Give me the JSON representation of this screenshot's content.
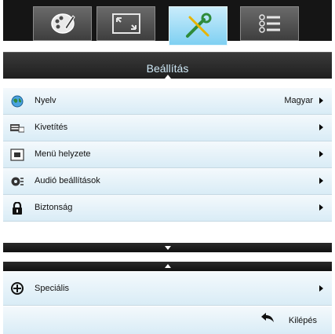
{
  "tabs": [
    {
      "icon": "palette-icon",
      "active": false
    },
    {
      "icon": "screen-icon",
      "active": false
    },
    {
      "icon": "tools-icon",
      "active": true
    },
    {
      "icon": "list-options-icon",
      "active": false
    }
  ],
  "header": {
    "title": "Beállítás"
  },
  "menu": {
    "items": [
      {
        "label": "Nyelv",
        "value": "Magyar",
        "icon": "globe-icon"
      },
      {
        "label": "Kivetítés",
        "value": "",
        "icon": "projection-icon"
      },
      {
        "label": "Menü helyzete",
        "value": "",
        "icon": "menu-position-icon"
      },
      {
        "label": "Audió beállítások",
        "value": "",
        "icon": "audio-settings-icon"
      },
      {
        "label": "Biztonság",
        "value": "",
        "icon": "lock-icon"
      }
    ]
  },
  "menu2": {
    "items": [
      {
        "label": "Speciális",
        "value": "",
        "icon": "advanced-icon"
      }
    ]
  },
  "footer": {
    "exit_label": "Kilépés",
    "exit_icon": "back-arrow-icon"
  },
  "colors": {
    "accent": "#7fd0f2",
    "title_text": "#cfe9f7",
    "row_bg": "#e6f2f9",
    "bar_bg": "#151515"
  }
}
